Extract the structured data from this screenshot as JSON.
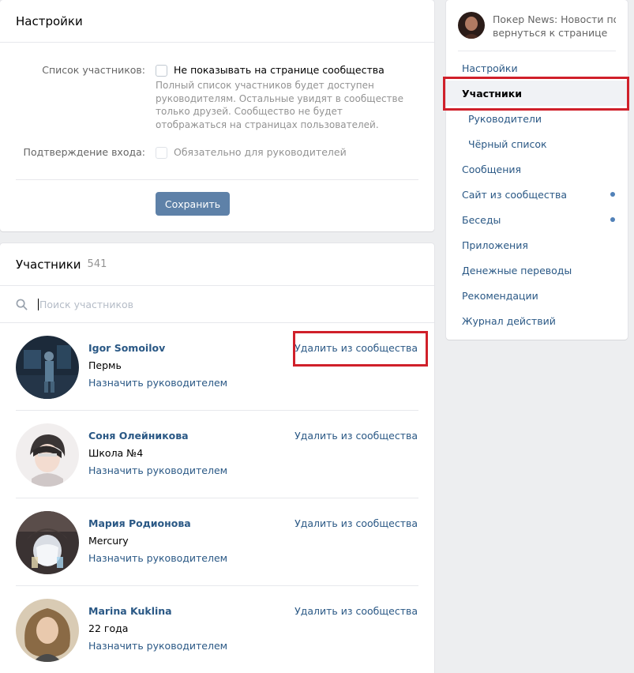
{
  "settings": {
    "title": "Настройки",
    "members_list_label": "Список участников:",
    "hide_members_label": "Не показывать на странице сообщества",
    "hide_members_hint": "Полный список участников будет доступен руководителям. Остальные увидят в сообществе только друзей. Сообщество не будет отображаться на страницах пользователей.",
    "login_confirm_label": "Подтверждение входа:",
    "required_for_managers_label": "Обязательно для руководителей",
    "save_label": "Сохранить"
  },
  "members": {
    "title": "Участники",
    "count": "541",
    "search_placeholder": "Поиск участников",
    "remove_label": "Удалить из сообщества",
    "promote_label": "Назначить руководителем",
    "items": [
      {
        "name": "Igor Somoilov",
        "subtitle": "Пермь"
      },
      {
        "name": "Соня Олейникова",
        "subtitle": "Школа №4"
      },
      {
        "name": "Мария Родионова",
        "subtitle": "Mercury"
      },
      {
        "name": "Marina Kuklina",
        "subtitle": "22 года"
      }
    ]
  },
  "nav": {
    "group_title": "Покер News: Новости по...",
    "back_label": "вернуться к странице",
    "items": [
      {
        "label": "Настройки"
      },
      {
        "label": "Участники"
      },
      {
        "label": "Руководители"
      },
      {
        "label": "Чёрный список"
      },
      {
        "label": "Сообщения"
      },
      {
        "label": "Сайт из сообщества"
      },
      {
        "label": "Беседы"
      },
      {
        "label": "Приложения"
      },
      {
        "label": "Денежные переводы"
      },
      {
        "label": "Рекомендации"
      },
      {
        "label": "Журнал действий"
      }
    ]
  },
  "colors": {
    "accent": "#2a5885",
    "button": "#5e81a8",
    "highlight": "#d0202a",
    "background": "#edeef0"
  }
}
